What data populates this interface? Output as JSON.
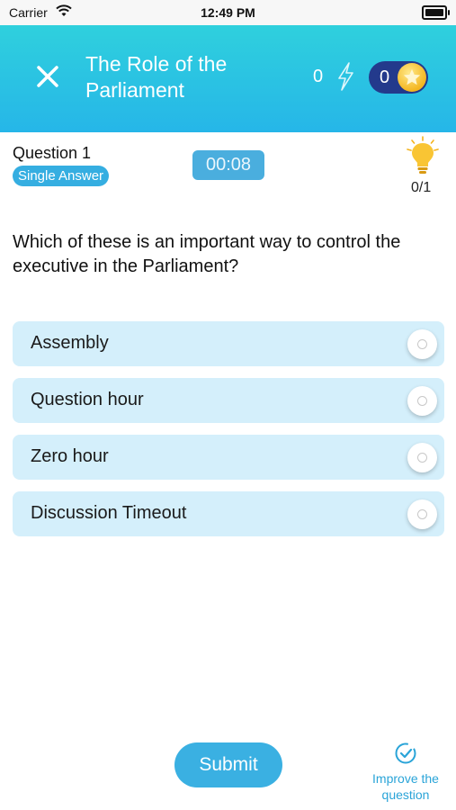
{
  "status_bar": {
    "carrier": "Carrier",
    "time": "12:49 PM"
  },
  "header": {
    "title": "The Role of the Parliament",
    "energy_count": "0",
    "coins_count": "0"
  },
  "question": {
    "label": "Question 1",
    "answer_type": "Single Answer",
    "timer": "00:08",
    "hints": "0/1",
    "text": "Which of these is an important way to control the executive in the Parliament?"
  },
  "options": [
    {
      "label": "Assembly"
    },
    {
      "label": "Question hour"
    },
    {
      "label": "Zero hour"
    },
    {
      "label": "Discussion Timeout"
    }
  ],
  "footer": {
    "submit_label": "Submit",
    "improve_label": "Improve the question"
  },
  "colors": {
    "header_gradient_top": "#2fd0dd",
    "header_gradient_bottom": "#26b6e8",
    "accent": "#3ab0e2",
    "option_bg": "#d4effb",
    "coins_pill": "#233a8c"
  }
}
